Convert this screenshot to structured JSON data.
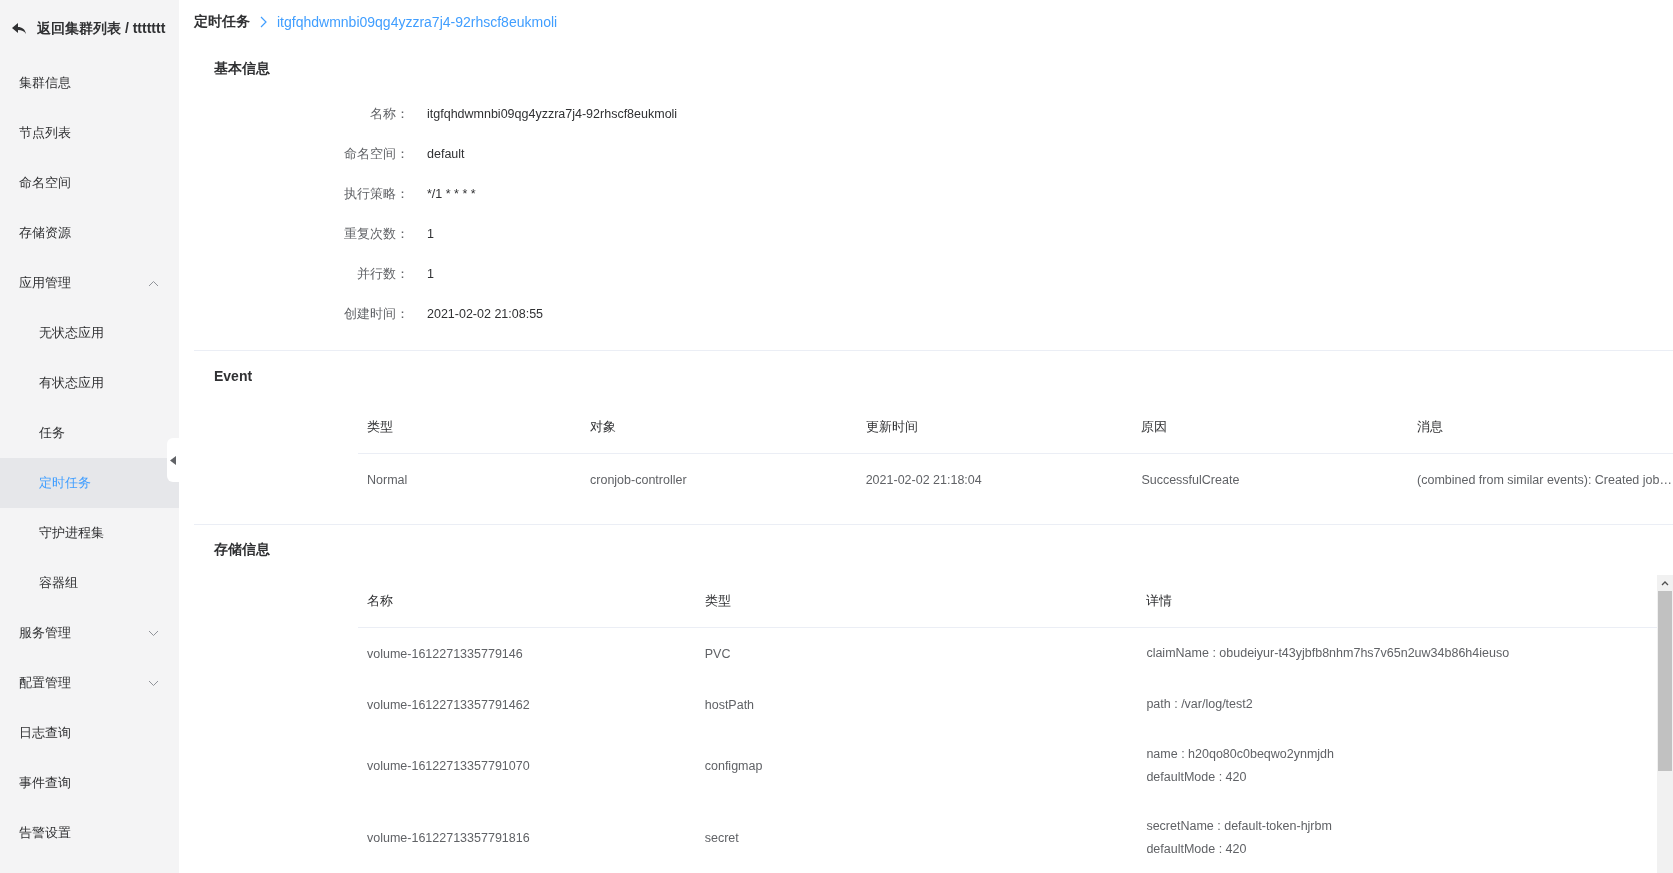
{
  "header": {
    "back_label": "返回集群列表 / ttttttt"
  },
  "sidebar": {
    "items": [
      {
        "label": "集群信息",
        "selected": false
      },
      {
        "label": "节点列表",
        "selected": false
      },
      {
        "label": "命名空间",
        "selected": false
      },
      {
        "label": "存储资源",
        "selected": false
      },
      {
        "label": "应用管理",
        "selected": false,
        "expanded": true,
        "children": [
          {
            "label": "无状态应用",
            "selected": false
          },
          {
            "label": "有状态应用",
            "selected": false
          },
          {
            "label": "任务",
            "selected": false
          },
          {
            "label": "定时任务",
            "selected": true
          },
          {
            "label": "守护进程集",
            "selected": false
          },
          {
            "label": "容器组",
            "selected": false
          }
        ]
      },
      {
        "label": "服务管理",
        "selected": false,
        "expanded": false
      },
      {
        "label": "配置管理",
        "selected": false,
        "expanded": false
      },
      {
        "label": "日志查询",
        "selected": false
      },
      {
        "label": "事件查询",
        "selected": false
      },
      {
        "label": "告警设置",
        "selected": false
      }
    ]
  },
  "breadcrumb": [
    {
      "label": "定时任务"
    },
    {
      "label": "itgfqhdwmnbi09qg4yzzra7j4-92rhscf8eukmoli"
    }
  ],
  "basic_info": {
    "title": "基本信息",
    "fields": [
      {
        "label": "名称：",
        "value": "itgfqhdwmnbi09qg4yzzra7j4-92rhscf8eukmoli"
      },
      {
        "label": "命名空间：",
        "value": "default"
      },
      {
        "label": "执行策略：",
        "value": "*/1 * * * *"
      },
      {
        "label": "重复次数：",
        "value": "1"
      },
      {
        "label": "并行数：",
        "value": "1"
      },
      {
        "label": "创建时间：",
        "value": "2021-02-02 21:08:55"
      }
    ]
  },
  "events": {
    "title": "Event",
    "columns": [
      "类型",
      "对象",
      "更新时间",
      "原因",
      "消息"
    ],
    "rows": [
      [
        "Normal",
        "cronjob-controller",
        "2021-02-02 21:18:04",
        "SuccessfulCreate",
        "(combined from similar events): Created job…"
      ]
    ]
  },
  "storage": {
    "title": "存储信息",
    "columns": [
      "名称",
      "类型",
      "详情"
    ],
    "rows": [
      {
        "name": "volume-1612271335779146",
        "type": "PVC",
        "details": [
          "claimName : obudeiyur-t43yjbfb8nhm7hs7v65n2uw34b86h4ieuso"
        ]
      },
      {
        "name": "volume-16122713357791462",
        "type": "hostPath",
        "details": [
          "path : /var/log/test2"
        ]
      },
      {
        "name": "volume-16122713357791070",
        "type": "configmap",
        "details": [
          "name : h20qo80c0beqwo2ynmjdh",
          "defaultMode : 420"
        ]
      },
      {
        "name": "volume-16122713357791816",
        "type": "secret",
        "details": [
          "secretName : default-token-hjrbm",
          "defaultMode : 420"
        ]
      }
    ]
  }
}
